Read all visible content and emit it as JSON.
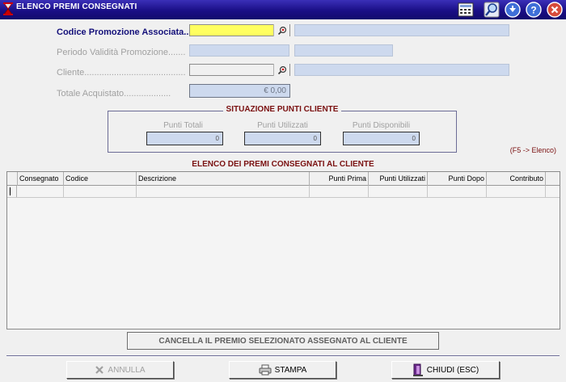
{
  "window": {
    "title": "ELENCO PREMI CONSEGNATI"
  },
  "form": {
    "codice_label": "Codice Promozione Associata....",
    "periodo_label": "Periodo Validità Promozione.......",
    "cliente_label": "Cliente.........................................",
    "totale_label": "Totale Acquistato...................",
    "totale_value": "€ 0,00"
  },
  "points": {
    "title": "SITUAZIONE PUNTI CLIENTE",
    "totali_label": "Punti Totali",
    "utilizzati_label": "Punti Utilizzati",
    "disponibili_label": "Punti Disponibili",
    "totali_value": "0",
    "utilizzati_value": "0",
    "disponibili_value": "0"
  },
  "hint": "(F5 -> Elenco)",
  "list": {
    "title": "ELENCO DEI PREMI CONSEGNATI AL CLIENTE",
    "columns": [
      "Consegnato",
      "Codice",
      "Descrizione",
      "Punti Prima",
      "Punti Utilizzati",
      "Punti Dopo",
      "Contributo"
    ]
  },
  "buttons": {
    "cancella": "CANCELLA IL PREMIO SELEZIONATO ASSEGNATO AL CLIENTE",
    "annulla": "ANNULLA",
    "stampa": "STAMPA",
    "chiudi": "CHIUDI (ESC)"
  },
  "colors": {
    "titlebar": "#1a0f86",
    "active_field": "#ffff60",
    "readonly_field": "#cdd9ee",
    "section_title": "#7a1010"
  },
  "icons": [
    "app-icon",
    "calculator-icon",
    "magnifier-icon",
    "download-icon",
    "help-icon",
    "close-icon",
    "search-icon",
    "printer-icon",
    "exit-door-icon",
    "cross-icon"
  ]
}
